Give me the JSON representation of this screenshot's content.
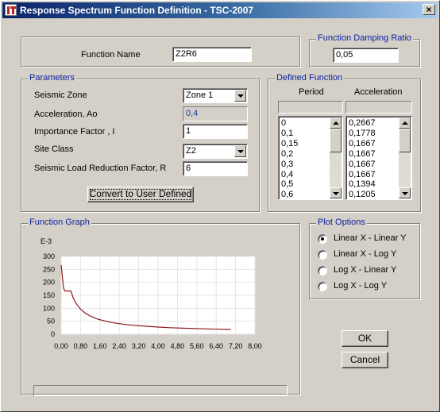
{
  "window": {
    "title": "Response Spectrum Function Definition - TSC-2007",
    "close_glyph": "×"
  },
  "function_name": {
    "label": "Function Name",
    "value": "Z2R6"
  },
  "damping": {
    "group_title": "Function Damping Ratio",
    "value": "0,05"
  },
  "parameters": {
    "group_title": "Parameters",
    "seismic_zone_label": "Seismic Zone",
    "seismic_zone_value": "Zone 1",
    "acceleration_label": "Acceleration, Ao",
    "acceleration_value": "0,4",
    "importance_label": "Importance Factor , I",
    "importance_value": "1",
    "site_class_label": "Site Class",
    "site_class_value": "Z2",
    "reduction_label": "Seismic Load Reduction Factor, R",
    "reduction_value": "6",
    "convert_button": "Convert to User Defined"
  },
  "defined_function": {
    "group_title": "Defined Function",
    "col_period": "Period",
    "col_acceleration": "Acceleration",
    "periods": [
      "0",
      "0,1",
      "0,15",
      "0,2",
      "0,3",
      "0,4",
      "0,5",
      "0,6"
    ],
    "accelerations": [
      "0,2667",
      "0,1778",
      "0,1667",
      "0,1667",
      "0,1667",
      "0,1667",
      "0,1394",
      "0,1205"
    ]
  },
  "function_graph": {
    "group_title": "Function Graph"
  },
  "plot_options": {
    "group_title": "Plot Options",
    "options": [
      "Linear X - Linear Y",
      "Linear X - Log Y",
      "Log X - Linear Y",
      "Log X - Log Y"
    ],
    "selected_index": 0
  },
  "buttons": {
    "ok": "OK",
    "cancel": "Cancel"
  },
  "colors": {
    "curve": "#8b1a1a",
    "group_title": "#0a1fa0"
  },
  "chart_data": {
    "type": "line",
    "y_unit_label": "E-3",
    "xlim": [
      0,
      8
    ],
    "ylim": [
      0,
      300
    ],
    "x_ticks": [
      "0,00",
      "0,80",
      "1,60",
      "2,40",
      "3,20",
      "4,00",
      "4,80",
      "5,60",
      "6,40",
      "7,20",
      "8,00"
    ],
    "y_ticks": [
      "300",
      "250",
      "200",
      "150",
      "100",
      "50",
      "0"
    ],
    "grid": true,
    "series": [
      {
        "x": [
          0,
          0.1,
          0.15,
          0.2,
          0.3,
          0.4,
          0.5,
          0.6,
          0.8,
          1.0,
          1.2,
          1.5,
          2.0,
          2.5,
          3.0,
          3.5,
          4.0,
          4.5,
          5.0,
          5.5,
          6.0,
          6.5,
          7.0
        ],
        "y": [
          266.7,
          177.8,
          166.7,
          166.7,
          166.7,
          166.7,
          139.4,
          120.5,
          96.3,
          80.8,
          70.0,
          58.5,
          46.5,
          39.3,
          34.2,
          30.5,
          27.6,
          25.2,
          23.3,
          21.7,
          20.4,
          19.2,
          18.2
        ]
      }
    ]
  }
}
